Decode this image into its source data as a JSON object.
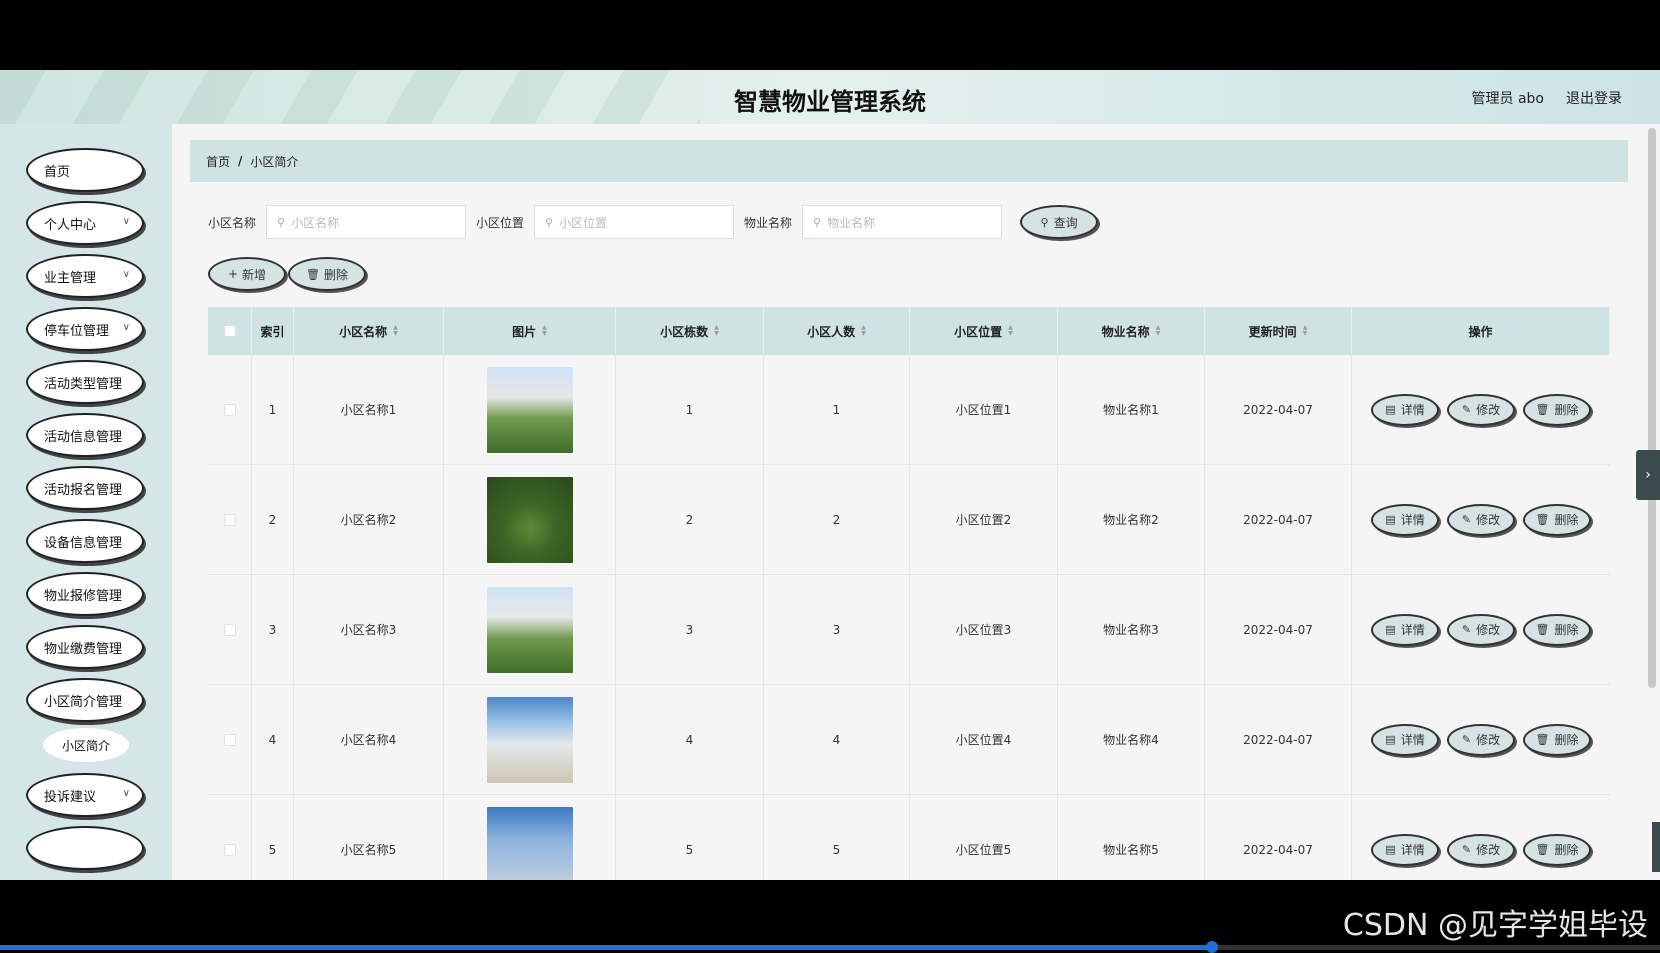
{
  "app": {
    "title": "智慧物业管理系统",
    "user_label": "管理员 abo",
    "logout_label": "退出登录"
  },
  "sidebar": {
    "items": [
      {
        "label": "首页",
        "chevron": false
      },
      {
        "label": "个人中心",
        "chevron": true
      },
      {
        "label": "业主管理",
        "chevron": true
      },
      {
        "label": "停车位管理",
        "chevron": true
      },
      {
        "label": "活动类型管理",
        "chevron": false
      },
      {
        "label": "活动信息管理",
        "chevron": false
      },
      {
        "label": "活动报名管理",
        "chevron": false
      },
      {
        "label": "设备信息管理",
        "chevron": false
      },
      {
        "label": "物业报修管理",
        "chevron": false
      },
      {
        "label": "物业缴费管理",
        "chevron": false
      },
      {
        "label": "小区简介管理",
        "chevron": false
      },
      {
        "label": "投诉建议",
        "chevron": true
      }
    ],
    "subitem": "小区简介"
  },
  "breadcrumb": {
    "home": "首页",
    "sep": "/",
    "current": "小区简介"
  },
  "search": {
    "name_label": "小区名称",
    "name_placeholder": "小区名称",
    "location_label": "小区位置",
    "location_placeholder": "小区位置",
    "property_label": "物业名称",
    "property_placeholder": "物业名称",
    "query_label": "查询"
  },
  "actions": {
    "add_label": "新增",
    "delete_label": "删除"
  },
  "table": {
    "headers": [
      "索引",
      "小区名称",
      "图片",
      "小区栋数",
      "小区人数",
      "小区位置",
      "物业名称",
      "更新时间",
      "操作"
    ],
    "rows": [
      {
        "index": "1",
        "name": "小区名称1",
        "buildings": "1",
        "people": "1",
        "location": "小区位置1",
        "property": "物业名称1",
        "updated": "2022-04-07"
      },
      {
        "index": "2",
        "name": "小区名称2",
        "buildings": "2",
        "people": "2",
        "location": "小区位置2",
        "property": "物业名称2",
        "updated": "2022-04-07"
      },
      {
        "index": "3",
        "name": "小区名称3",
        "buildings": "3",
        "people": "3",
        "location": "小区位置3",
        "property": "物业名称3",
        "updated": "2022-04-07"
      },
      {
        "index": "4",
        "name": "小区名称4",
        "buildings": "4",
        "people": "4",
        "location": "小区位置4",
        "property": "物业名称4",
        "updated": "2022-04-07"
      },
      {
        "index": "5",
        "name": "小区名称5",
        "buildings": "5",
        "people": "5",
        "location": "小区位置5",
        "property": "物业名称5",
        "updated": "2022-04-07"
      }
    ],
    "row_buttons": {
      "detail": "详情",
      "edit": "修改",
      "delete": "删除"
    }
  },
  "watermark": "CSDN @见字学姐毕设",
  "video_progress": 0.73,
  "colors": {
    "header_bg": "#d9ebe6",
    "sidebar_bg": "#d4e6e8",
    "table_header_bg": "#cfe2e4",
    "progress": "#1e6fd9"
  }
}
